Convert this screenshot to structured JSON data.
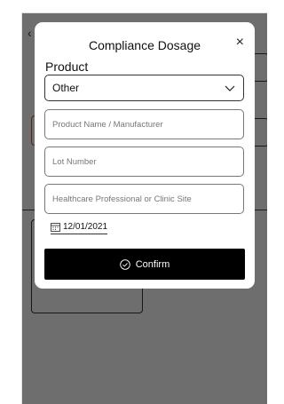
{
  "modal": {
    "title": "Compliance Dosage",
    "close_symbol": "×",
    "product_label": "Product",
    "product_selected": "Other",
    "fields": {
      "product_name_placeholder": "Product Name / Manufacturer",
      "lot_number_placeholder": "Lot Number",
      "site_placeholder": "Healthcare Professional or Clinic Site"
    },
    "date_value": "12/01/2021",
    "confirm_label": "Confirm"
  },
  "icons": {
    "close": "close-icon",
    "select": "chevron-down-icon",
    "date": "calendar-icon",
    "confirm": "check-circle-icon"
  },
  "colors": {
    "primary_button": "#000000",
    "scrim": "#000000",
    "background": "#f4f4f4"
  }
}
